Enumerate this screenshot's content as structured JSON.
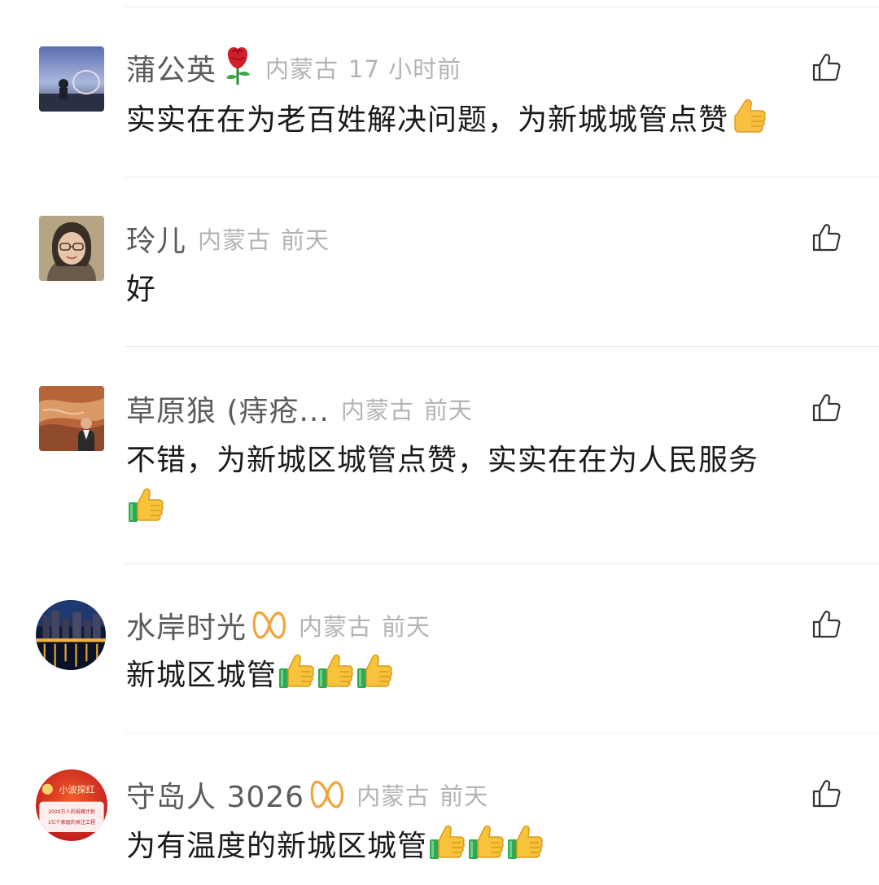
{
  "comments": [
    {
      "name": "蒲公英",
      "location": "内蒙古",
      "time": "17 小时前",
      "text": "实实在在为老百姓解决问题，为新城城管点赞"
    },
    {
      "name": "玲儿",
      "location": "内蒙古",
      "time": "前天",
      "text": "好"
    },
    {
      "name": "草原狼 (痔疮...",
      "location": "内蒙古",
      "time": "前天",
      "text": "不错，为新城区城管点赞，实实在在为人民服务"
    },
    {
      "name": "水岸时光",
      "location": "内蒙古",
      "time": "前天",
      "text": "新城区城管"
    },
    {
      "name": "守岛人 3026",
      "location": "内蒙古",
      "time": "前天",
      "text": "为有温度的新城区城管",
      "avatar_text": {
        "title": "小波探红",
        "line1": "2000万人的捐赠计划",
        "line2": "1亿个家庭的关注工程"
      }
    }
  ],
  "icons": {
    "like": "thumbs-up-outline-icon",
    "rose": "rose-emoji",
    "thumbs": "thumbs-up-emoji",
    "vip": "infinity-badge-icon"
  },
  "colors": {
    "name": "#5b5b5b",
    "meta": "#b3b3b3",
    "text": "#1a1a1a",
    "divider": "#e8e8e8",
    "badge": "#f0a43a"
  }
}
